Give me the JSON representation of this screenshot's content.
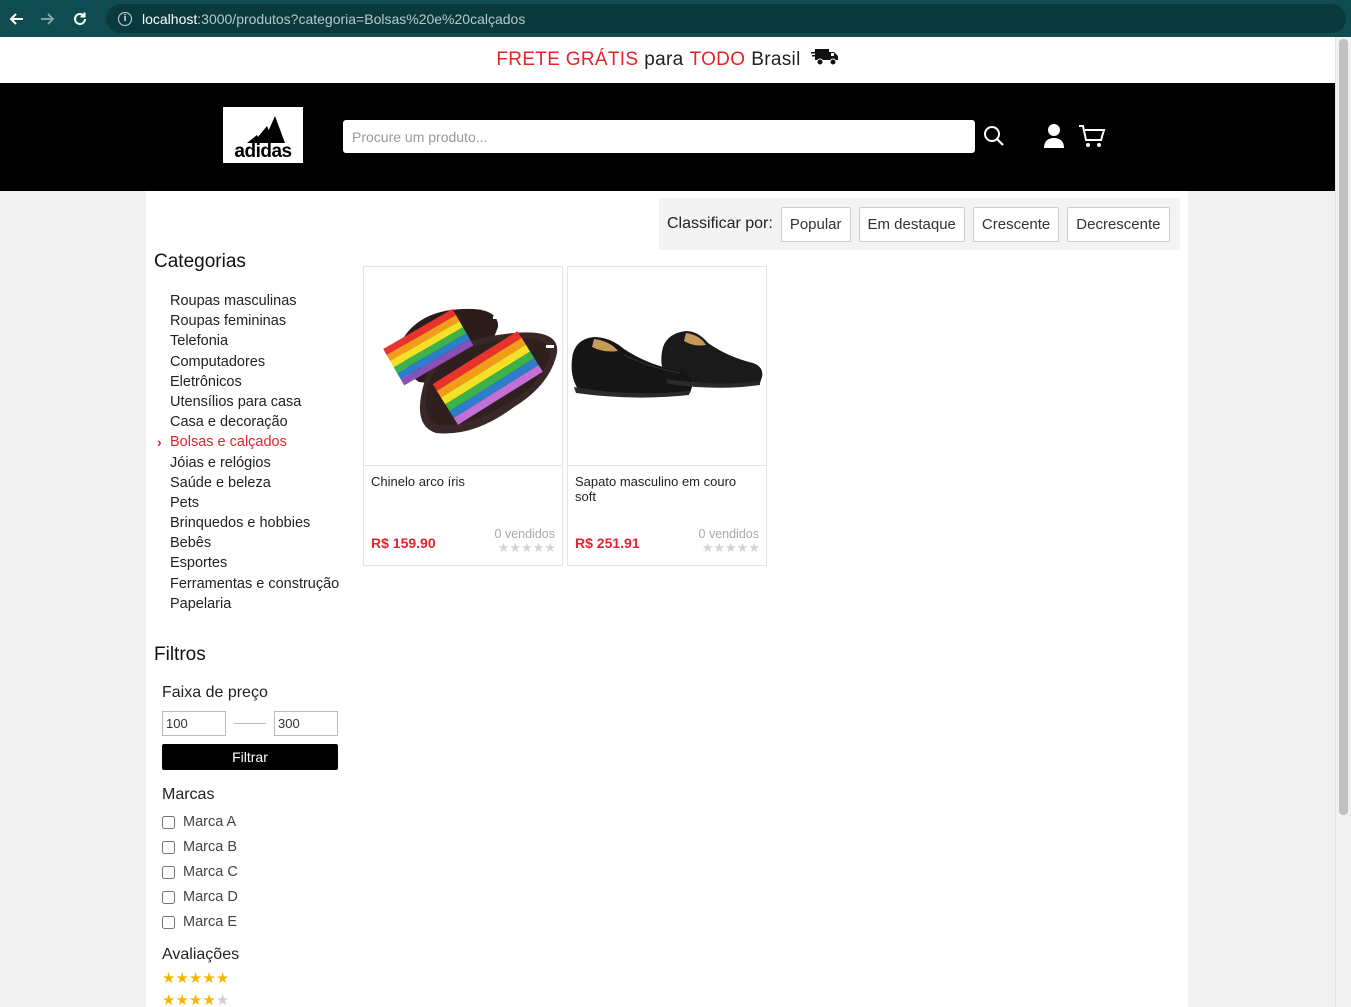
{
  "browser": {
    "url_host": "localhost",
    "url_rest": ":3000/produtos?categoria=Bolsas%20e%20calçados"
  },
  "promo": {
    "part1": "FRETE GRÁTIS",
    "part2": "para",
    "part3": "TODO",
    "part4": "Brasil"
  },
  "header": {
    "logo_text": "adidas",
    "search_placeholder": "Procure um produto..."
  },
  "sort": {
    "label": "Classificar por:",
    "options": [
      "Popular",
      "Em destaque",
      "Crescente",
      "Decrescente"
    ]
  },
  "categories": {
    "title": "Categorias",
    "items": [
      "Roupas masculinas",
      "Roupas femininas",
      "Telefonia",
      "Computadores",
      "Eletrônicos",
      "Utensílios para casa",
      "Casa e decoração",
      "Bolsas e calçados",
      "Jóias e relógios",
      "Saúde e beleza",
      "Pets",
      "Brinquedos e hobbies",
      "Bebês",
      "Esportes",
      "Ferramentas e construção",
      "Papelaria"
    ],
    "active": "Bolsas e calçados"
  },
  "filters": {
    "title": "Filtros",
    "price_title": "Faixa de preço",
    "price_min": "100",
    "price_max": "300",
    "filter_button": "Filtrar",
    "brands_title": "Marcas",
    "brands": [
      "Marca A",
      "Marca B",
      "Marca C",
      "Marca D",
      "Marca E"
    ],
    "ratings_title": "Avaliações",
    "ratings": [
      5,
      4
    ]
  },
  "products": [
    {
      "name": "Chinelo arco íris",
      "price": "R$ 159.90",
      "sold": "0 vendidos",
      "rating": 0
    },
    {
      "name": "Sapato masculino em couro soft",
      "price": "R$ 251.91",
      "sold": "0 vendidos",
      "rating": 0
    }
  ],
  "colors": {
    "accent": "#e3242b",
    "star": "#f5b800",
    "header_bg": "#000000",
    "browser_bg": "#0f4c51"
  }
}
